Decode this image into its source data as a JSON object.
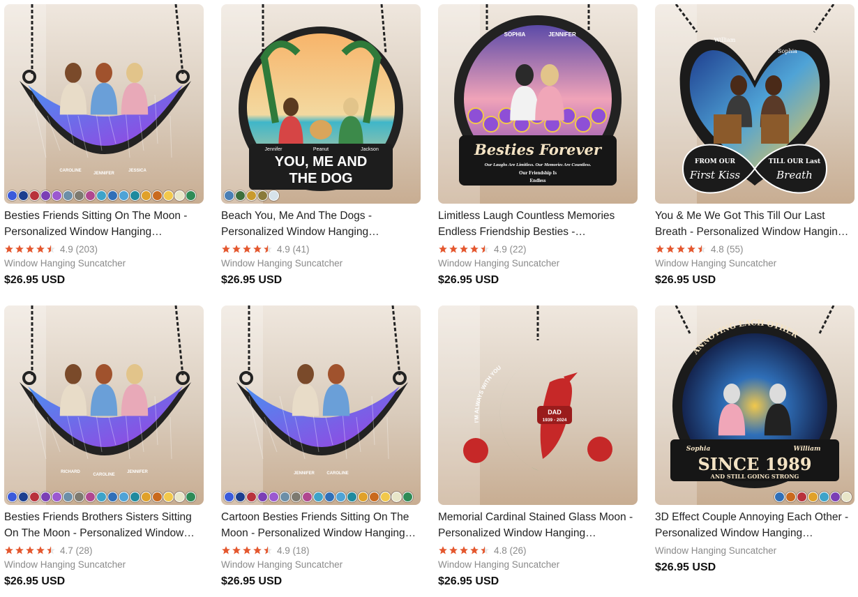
{
  "colors": {
    "star": "#e4572e",
    "muted": "#8a8a8a",
    "price": "#111111"
  },
  "products": [
    {
      "title": "Besties Friends Sitting On The Moon - Personalized Window Hanging Suncatcher",
      "rating": 4.5,
      "rating_label": "4.9 (203)",
      "category": "Window Hanging Suncatcher",
      "price": "$26.95 USD",
      "art": "moon",
      "art_names": [
        "CAROLINE",
        "JENNIFER",
        "JESSICA"
      ],
      "swatches": [
        "#3b5bdb",
        "#1c3f8f",
        "#b8323c",
        "#7b3fb5",
        "#9b59d0",
        "#6c8fa8",
        "#7d7a70",
        "#b0478f",
        "#3da3c9",
        "#2f6fb8",
        "#4fa3d6",
        "#1f8a9e",
        "#e0a12a",
        "#c96a1e",
        "#f2c84b",
        "#e8e6c8",
        "#2e8b57"
      ]
    },
    {
      "title": "Beach You, Me And The Dogs - Personalized Window Hanging Suncatcher",
      "rating": 4.5,
      "rating_label": "4.9 (41)",
      "category": "Window Hanging Suncatcher",
      "price": "$26.95 USD",
      "art": "circle",
      "art_names": [
        "Jennifer",
        "Peanut",
        "Jackson"
      ],
      "art_caption": "YOU, ME AND THE DOG",
      "swatches": [
        "#4a7fb5",
        "#3c6e3c",
        "#c99a2e",
        "#8a7a3a",
        "#d6e2ea"
      ]
    },
    {
      "title": "Limitless Laugh Countless Memories Endless Friendship Besties - Personalized Window Hanging Suncatcher",
      "rating": 4.5,
      "rating_label": "4.9 (22)",
      "category": "Window Hanging Suncatcher",
      "price": "$26.95 USD",
      "art": "besties",
      "art_names": [
        "SOPHIA",
        "JENNIFER"
      ],
      "art_caption": "Besties Forever",
      "art_sub": "Our Laughs Are Limitless. Our Memories Are Countless. Our Friendship Is Endless",
      "swatches": []
    },
    {
      "title": "You & Me We Got This Till Our Last Breath - Personalized Window Hanging Suncatcher",
      "rating": 4.5,
      "rating_label": "4.8 (55)",
      "category": "Window Hanging Suncatcher",
      "price": "$26.95 USD",
      "art": "infinity",
      "art_names": [
        "William",
        "Sophia"
      ],
      "art_caption_left": "FROM OUR First Kiss",
      "art_caption_right": "TILL OUR Last Breath",
      "swatches": []
    },
    {
      "title": "Besties Friends Brothers Sisters Sitting On The Moon - Personalized Window Hanging Suncatcher",
      "rating": 4.5,
      "rating_label": "4.7 (28)",
      "category": "Window Hanging Suncatcher",
      "price": "$26.95 USD",
      "art": "moon",
      "art_names": [
        "RICHARD",
        "CAROLINE",
        "JENNIFER"
      ],
      "swatches": [
        "#3b5bdb",
        "#1c3f8f",
        "#b8323c",
        "#7b3fb5",
        "#9b59d0",
        "#6c8fa8",
        "#7d7a70",
        "#b0478f",
        "#3da3c9",
        "#2f6fb8",
        "#4fa3d6",
        "#1f8a9e",
        "#e0a12a",
        "#c96a1e",
        "#f2c84b",
        "#e8e6c8",
        "#2e8b57"
      ]
    },
    {
      "title": "Cartoon Besties Friends Sitting On The Moon - Personalized Window Hanging Suncatcher",
      "rating": 4.5,
      "rating_label": "4.9 (18)",
      "category": "Window Hanging Suncatcher",
      "price": "$26.95 USD",
      "art": "moon",
      "art_names": [
        "JENNIFER",
        "CAROLINE"
      ],
      "swatches": [
        "#3b5bdb",
        "#1c3f8f",
        "#b8323c",
        "#7b3fb5",
        "#9b59d0",
        "#6c8fa8",
        "#7d7a70",
        "#b0478f",
        "#3da3c9",
        "#2f6fb8",
        "#4fa3d6",
        "#1f8a9e",
        "#e0a12a",
        "#c96a1e",
        "#f2c84b",
        "#e8e6c8",
        "#2e8b57"
      ]
    },
    {
      "title": "Memorial Cardinal Stained Glass Moon - Personalized Window Hanging Suncatcher",
      "rating": 4.5,
      "rating_label": "4.8 (26)",
      "category": "Window Hanging Suncatcher",
      "price": "$26.95 USD",
      "art": "cardinal",
      "art_names": [
        "DAD",
        "1939 - 2024"
      ],
      "art_caption": "I'M ALWAYS WITH YOU",
      "swatches": []
    },
    {
      "title": "3D Effect Couple Annoying Each Other - Personalized Window Hanging Suncatcher",
      "rating": null,
      "rating_label": "",
      "category": "Window Hanging Suncatcher",
      "price": "$26.95 USD",
      "art": "since",
      "art_names": [
        "Sophia",
        "William"
      ],
      "art_caption": "ANNOYING EACH OTHER",
      "art_sub": "SINCE 1989",
      "art_sub2": "AND STILL GOING STRONG",
      "swatches_right": [
        "#2f6fb8",
        "#c96a1e",
        "#b8323c",
        "#e0a12a",
        "#3da3c9",
        "#7b3fb5",
        "#e8e6c8"
      ]
    }
  ]
}
